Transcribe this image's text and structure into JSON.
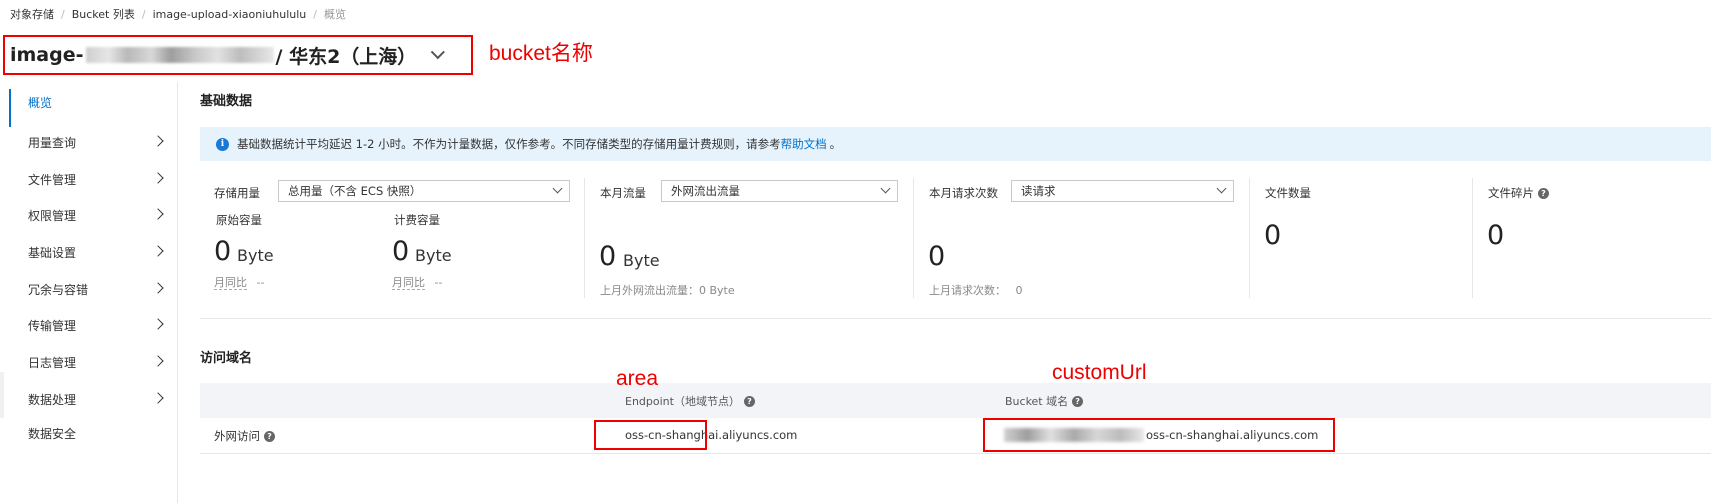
{
  "breadcrumb": [
    "对象存储",
    "Bucket 列表",
    "image-upload-xiaoniuhululu",
    "概览"
  ],
  "header": {
    "title_prefix": "image-",
    "title_suffix": "/ 华东2（上海）"
  },
  "annotations": {
    "bucket": "bucket名称",
    "area": "area",
    "custom_url": "customUrl"
  },
  "sidebar": {
    "items": [
      {
        "label": "概览",
        "active": true,
        "expandable": false
      },
      {
        "label": "用量查询",
        "expandable": true
      },
      {
        "label": "文件管理",
        "expandable": true
      },
      {
        "label": "权限管理",
        "expandable": true
      },
      {
        "label": "基础设置",
        "expandable": true
      },
      {
        "label": "冗余与容错",
        "expandable": true
      },
      {
        "label": "传输管理",
        "expandable": true
      },
      {
        "label": "日志管理",
        "expandable": true
      },
      {
        "label": "数据处理",
        "expandable": true
      },
      {
        "label": "数据安全",
        "expandable": false
      }
    ]
  },
  "basic_data": {
    "title": "基础数据",
    "notice": {
      "text": "基础数据统计平均延迟 1-2 小时。不作为计量数据，仅作参考。不同存储类型的存储用量计费规则，请参考",
      "link": "帮助文档",
      "suffix": "。"
    },
    "storage": {
      "label": "存储用量",
      "select": "总用量（不含 ECS 快照）",
      "original": {
        "label": "原始容量",
        "value": "0",
        "unit": "Byte",
        "compare_label": "月同比",
        "compare_value": "--"
      },
      "billing": {
        "label": "计费容量",
        "value": "0",
        "unit": "Byte",
        "compare_label": "月同比",
        "compare_value": "--"
      }
    },
    "traffic": {
      "label": "本月流量",
      "select": "外网流出流量",
      "value": "0",
      "unit": "Byte",
      "last_month": "上月外网流出流量：0 Byte"
    },
    "requests": {
      "label": "本月请求次数",
      "select": "读请求",
      "value": "0",
      "last_month_label": "上月请求次数：",
      "last_month_value": "0"
    },
    "file_count": {
      "label": "文件数量",
      "value": "0"
    },
    "file_fragments": {
      "label": "文件碎片",
      "value": "0"
    }
  },
  "access_domain": {
    "title": "访问域名",
    "columns": [
      "Endpoint（地域节点）",
      "Bucket 域名"
    ],
    "rows": [
      {
        "type": "外网访问",
        "endpoint": "oss-cn-shanghai.aliyuncs.com",
        "bucket_domain_suffix": "oss-cn-shanghai.aliyuncs.com"
      }
    ]
  },
  "colors": {
    "accent": "#0070cc",
    "annotation_red": "#e00000",
    "notice_bg": "#e6f3fc"
  }
}
